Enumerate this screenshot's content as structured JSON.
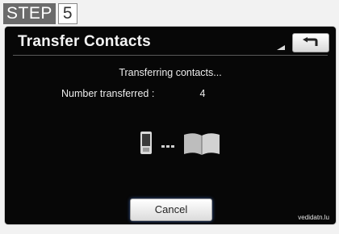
{
  "step": {
    "word": "STEP",
    "number": "5"
  },
  "screen": {
    "title": "Transfer Contacts",
    "message": "Transferring contacts...",
    "count_label": "Number transferred :",
    "count_value": "4",
    "cancel_label": "Cancel",
    "back_icon": "back-arrow-icon",
    "signal_icon": "signal-icon"
  },
  "watermark": "vedidatn.lu",
  "colors": {
    "screen_bg": "#070707",
    "text": "#ececec",
    "button_bg": "#e8e8e8",
    "back_arrow": "#222222",
    "badge_bg": "#6b6b6b"
  }
}
